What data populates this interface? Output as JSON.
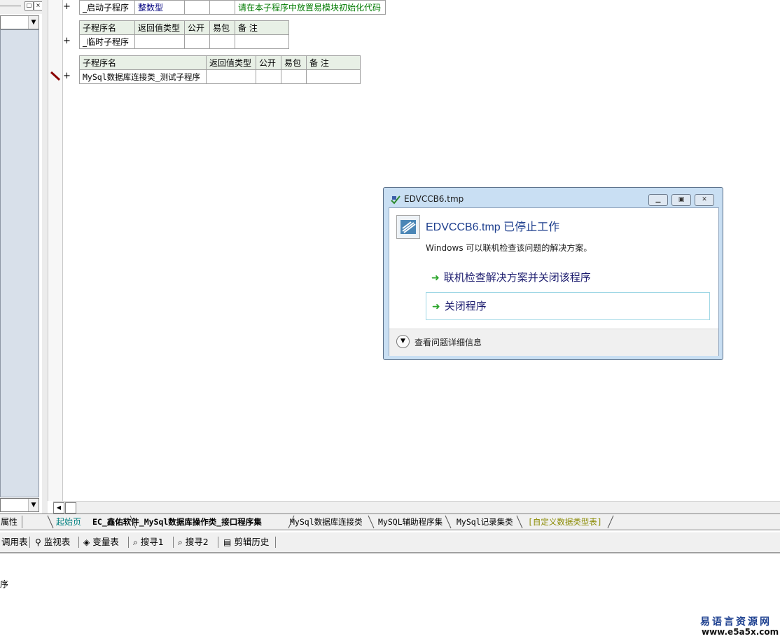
{
  "code_tables": [
    {
      "header": null,
      "rows": [
        [
          "_启动子程序",
          "整数型",
          "",
          "",
          "请在本子程序中放置易模块初始化代码"
        ]
      ]
    },
    {
      "header": [
        "子程序名",
        "返回值类型",
        "公开",
        "易包",
        "备 注"
      ],
      "rows": [
        [
          "_临时子程序",
          "",
          "",
          "",
          ""
        ]
      ]
    },
    {
      "header": [
        "子程序名",
        "返回值类型",
        "公开",
        "易包",
        "备 注"
      ],
      "rows": [
        [
          "MySql数据库连接类_测试子程序",
          "",
          "",
          "",
          ""
        ]
      ]
    }
  ],
  "gutter": {
    "expand_symbol": "+"
  },
  "tabs": {
    "props_label": "属性",
    "items": [
      {
        "label": "起始页",
        "color": "#008080"
      },
      {
        "label": "EC_鑫佑软件_MySql数据库操作类_接口程序集",
        "color": "#000000",
        "active": true
      },
      {
        "label": "MySql数据库连接类",
        "color": "#000000"
      },
      {
        "label": "MySQL辅助程序集",
        "color": "#000000"
      },
      {
        "label": "MySql记录集类",
        "color": "#000000"
      },
      {
        "label": "[自定义数据类型表]",
        "color": "#8a8a00"
      }
    ]
  },
  "toolbar": {
    "items": [
      {
        "label": "调用表",
        "icon": "call-table-icon"
      },
      {
        "label": "监视表",
        "icon": "magnifier-icon"
      },
      {
        "label": "变量表",
        "icon": "variable-icon"
      },
      {
        "label": "搜寻1",
        "icon": "search-doc-icon"
      },
      {
        "label": "搜寻2",
        "icon": "search-doc-icon"
      },
      {
        "label": "剪辑历史",
        "icon": "clipboard-icon"
      }
    ]
  },
  "output": {
    "text": "序"
  },
  "dialog": {
    "title": "EDVCCB6.tmp",
    "heading": "EDVCCB6.tmp 已停止工作",
    "subtext": "Windows 可以联机检查该问题的解决方案。",
    "option1": "联机检查解决方案并关闭该程序",
    "option2": "关闭程序",
    "details": "查看问题详细信息"
  },
  "watermark": {
    "cn": "易语言资源网",
    "url": "www.e5a5x.com"
  }
}
